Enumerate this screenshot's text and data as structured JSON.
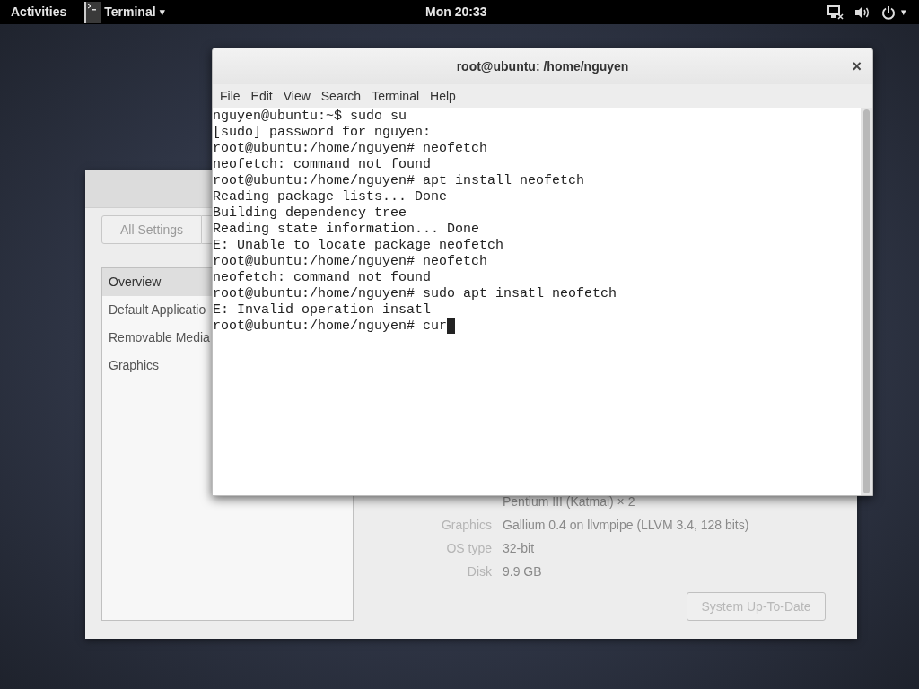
{
  "top_bar": {
    "activities": "Activities",
    "app_menu": {
      "label": "Terminal",
      "caret": "▾"
    },
    "clock": "Mon 20:33",
    "system_caret": "▾"
  },
  "settings_window": {
    "all_settings_button": "All Settings",
    "sidebar": {
      "items": [
        {
          "label": "Overview",
          "selected": true
        },
        {
          "label": "Default Applicatio",
          "selected": false
        },
        {
          "label": "Removable Media",
          "selected": false
        },
        {
          "label": "Graphics",
          "selected": false
        }
      ]
    },
    "details": [
      {
        "value": "Pentium III (Katmai) × 2"
      },
      {
        "label": "Graphics",
        "value": "Gallium 0.4 on llvmpipe (LLVM 3.4, 128 bits)"
      },
      {
        "label": "OS type",
        "value": "32-bit"
      },
      {
        "label": "Disk",
        "value": "9.9 GB"
      }
    ],
    "update_button": {
      "label": "System Up-To-Date",
      "disabled": true
    }
  },
  "terminal": {
    "title": "root@ubuntu: /home/nguyen",
    "close": "×",
    "menu": [
      "File",
      "Edit",
      "View",
      "Search",
      "Terminal",
      "Help"
    ],
    "lines": [
      "nguyen@ubuntu:~$ sudo su",
      "[sudo] password for nguyen:",
      "root@ubuntu:/home/nguyen# neofetch",
      "neofetch: command not found",
      "root@ubuntu:/home/nguyen# apt install neofetch",
      "Reading package lists... Done",
      "Building dependency tree",
      "Reading state information... Done",
      "E: Unable to locate package neofetch",
      "root@ubuntu:/home/nguyen# neofetch",
      "neofetch: command not found",
      "root@ubuntu:/home/nguyen# sudo apt insatl neofetch",
      "E: Invalid operation insatl",
      "root@ubuntu:/home/nguyen# cur"
    ],
    "cursor_visible": true
  }
}
